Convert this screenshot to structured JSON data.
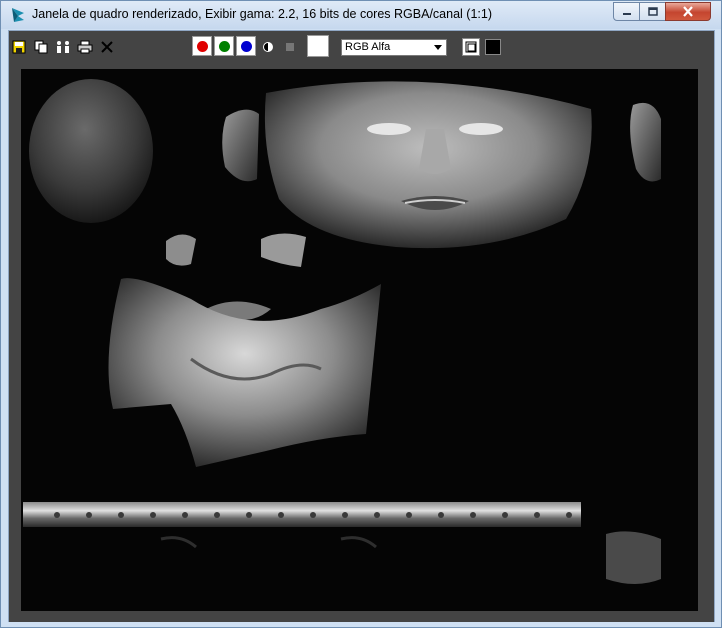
{
  "window": {
    "title": "Janela de quadro renderizado, Exibir gama: 2.2, 16 bits de cores RGBA/canal (1:1)",
    "icon": "3dsmax-app-icon"
  },
  "controls": {
    "minimize": "minimize-icon",
    "maximize": "maximize-icon",
    "close": "close-icon"
  },
  "toolbar": {
    "buttons": [
      "save-icon",
      "copy-icon",
      "clone-icon",
      "print-icon",
      "clear-icon"
    ],
    "channels": [
      {
        "name": "red",
        "color": "#e00000"
      },
      {
        "name": "green",
        "color": "#008000"
      },
      {
        "name": "blue",
        "color": "#0000d0"
      }
    ],
    "channel_select": "RGB Alfa"
  },
  "colors": {
    "toolbar_bg": "#444444",
    "title_bar": "#cfe0f3"
  }
}
